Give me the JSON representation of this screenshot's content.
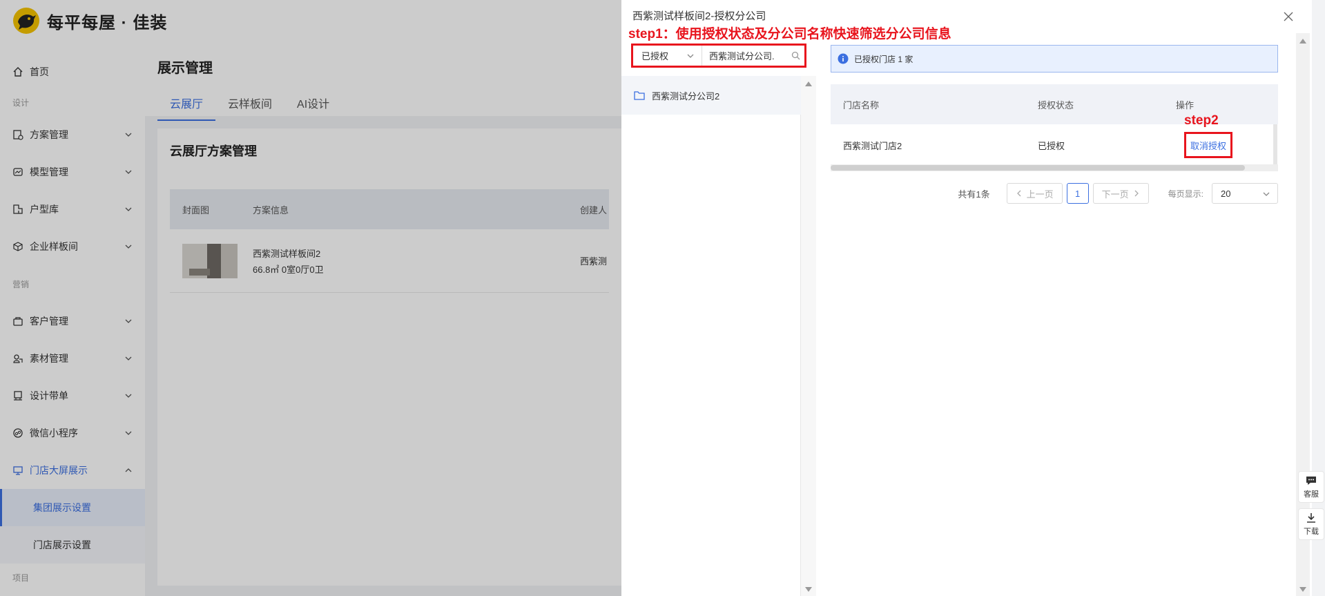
{
  "header": {
    "brand": "每平每屋 · 佳装"
  },
  "sidebar": {
    "items": [
      {
        "label": "首页",
        "icon": "home-icon"
      },
      {
        "group": "设计"
      },
      {
        "label": "方案管理",
        "icon": "scheme-icon"
      },
      {
        "label": "模型管理",
        "icon": "model-icon"
      },
      {
        "label": "户型库",
        "icon": "floorplan-icon"
      },
      {
        "label": "企业样板间",
        "icon": "showroom-icon"
      },
      {
        "group": "营销"
      },
      {
        "label": "客户管理",
        "icon": "customer-icon"
      },
      {
        "label": "素材管理",
        "icon": "material-icon"
      },
      {
        "label": "设计带单",
        "icon": "order-icon"
      },
      {
        "label": "微信小程序",
        "icon": "miniapp-icon"
      },
      {
        "label": "门店大屏展示",
        "icon": "screen-icon"
      },
      {
        "sub": "集团展示设置"
      },
      {
        "sub": "门店展示设置"
      },
      {
        "group": "项目"
      }
    ]
  },
  "main": {
    "title": "展示管理",
    "tabs": [
      "云展厅",
      "云样板间",
      "AI设计"
    ],
    "card_title": "云展厅方案管理",
    "table": {
      "headers": [
        "封面图",
        "方案信息",
        "创建人"
      ],
      "rows": [
        {
          "name": "西紫测试样板间2",
          "info": "66.8㎡ 0室0厅0卫",
          "creator": "西紫测"
        }
      ]
    }
  },
  "drawer": {
    "title": "西紫测试样板间2-授权分公司",
    "annotation_step1": "step1：使用授权状态及分公司名称快速筛选分公司信息",
    "status_select": "已授权",
    "search_value": "西紫测试分公司.",
    "tree": [
      "西紫测试分公司2"
    ],
    "info_text": "已授权门店 1 家",
    "table": {
      "headers": [
        "门店名称",
        "授权状态",
        "操作"
      ],
      "rows": [
        {
          "store": "西紫测试门店2",
          "status": "已授权",
          "action": "取消授权"
        }
      ]
    },
    "annotation_step2": "step2",
    "pagination": {
      "total": "共有1条",
      "prev": "上一页",
      "page": "1",
      "next": "下一页",
      "per_page_label": "每页显示:",
      "per_page": "20"
    }
  },
  "float": {
    "service": "客服",
    "download": "下载"
  },
  "colors": {
    "accent": "#3b6fe0",
    "annotation": "#e8141d",
    "brand": "#f6c400"
  }
}
